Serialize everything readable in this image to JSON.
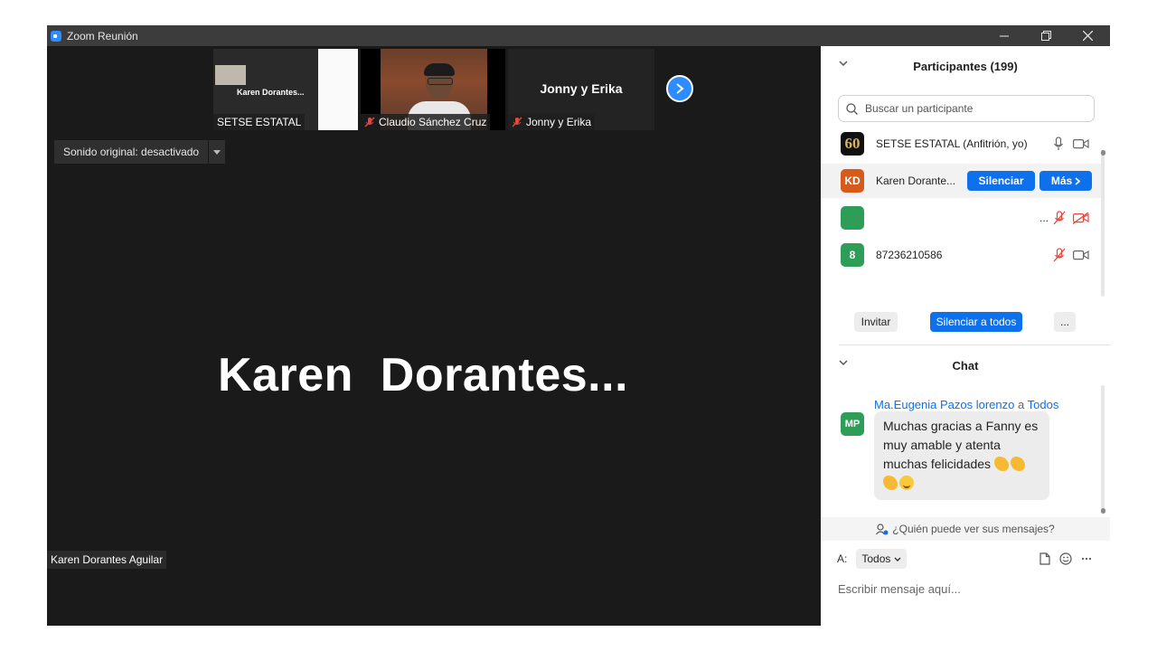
{
  "window": {
    "title": "Zoom Reunión"
  },
  "thumbnails": [
    {
      "name": "SETSE ESTATAL",
      "inner_title": "Karen Dorantes..."
    },
    {
      "name": "Claudio Sánchez Cruz"
    },
    {
      "name": "Jonny y Erika",
      "title": "Jonny y Erika"
    }
  ],
  "stage": {
    "sound_label": "Sonido original: desactivado",
    "speaker_display": "Karen  Dorantes...",
    "speaker_name_tag": "Karen Dorantes Aguilar"
  },
  "participants": {
    "header": "Participantes (199)",
    "search_placeholder": "Buscar un participante",
    "rows": [
      {
        "avatar_text": "60",
        "name": "SETSE ESTATAL (Anfitrión, yo)"
      },
      {
        "avatar_text": "KD",
        "name": "Karen Dorante...",
        "mute_label": "Silenciar",
        "more_label": "Más"
      },
      {
        "avatar_text": "",
        "name": "..."
      },
      {
        "avatar_text": "8",
        "name": "87236210586"
      }
    ],
    "invite_label": "Invitar",
    "mute_all_label": "Silenciar a todos",
    "more_label": "..."
  },
  "chat": {
    "header": "Chat",
    "sender": "Ma.Eugenia Pazos lorenzo",
    "to_word": "a",
    "recipient": "Todos",
    "avatar_text": "MP",
    "message": "Muchas gracias a Fanny es muy amable y atenta muchas felicidades",
    "who_can_see": "¿Quién puede ver sus mensajes?",
    "to_label": "A:",
    "to_value": "Todos",
    "input_placeholder": "Escribir mensaje aquí..."
  },
  "colors": {
    "accent": "#0e71eb",
    "kd_avatar": "#d65a1a",
    "green_avatar": "#2e9d57",
    "muted_red": "#e8453c"
  }
}
